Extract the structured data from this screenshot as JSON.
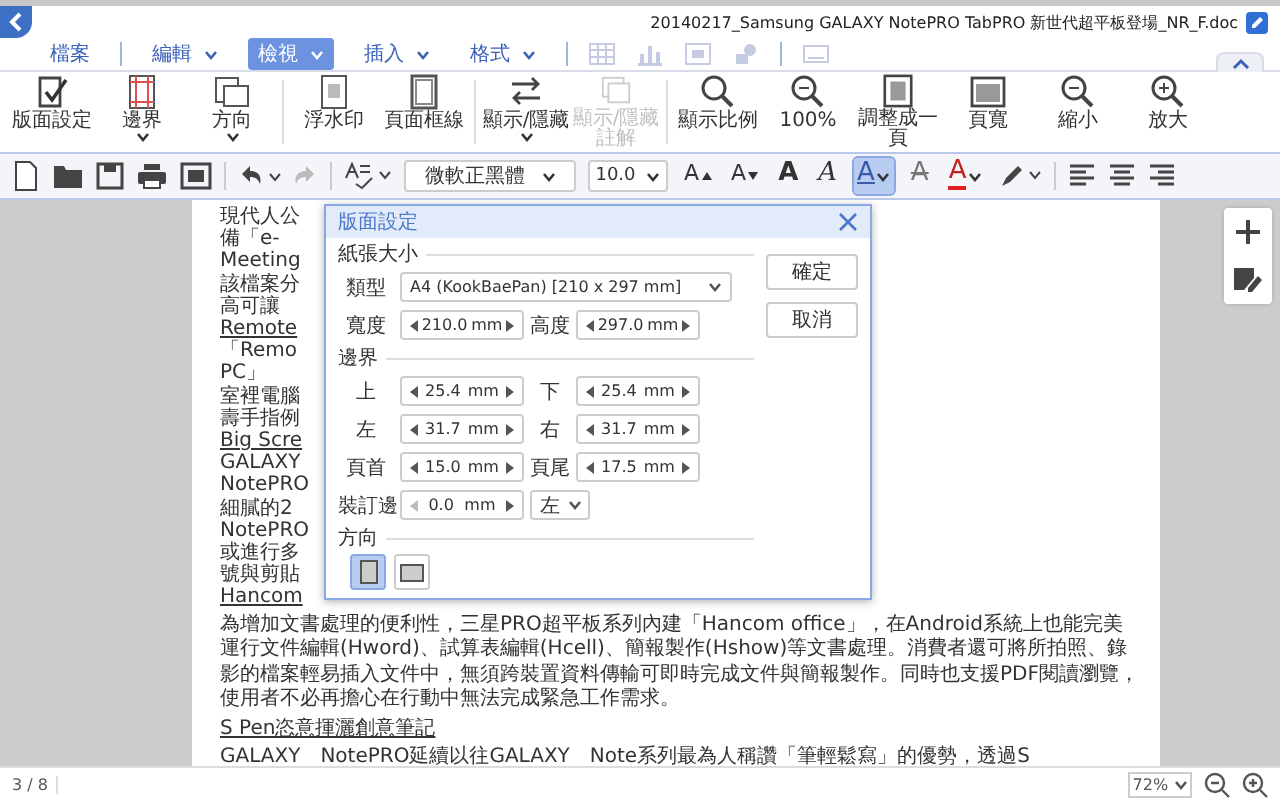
{
  "window": {
    "title": "20140217_Samsung GALAXY NotePRO  TabPRO 新世代超平板登場_NR_F.doc"
  },
  "menu_tabs": [
    {
      "label": "檔案",
      "dropdown": false,
      "selected": false
    },
    {
      "label": "編輯",
      "dropdown": true,
      "selected": false
    },
    {
      "label": "檢視",
      "dropdown": true,
      "selected": true
    },
    {
      "label": "插入",
      "dropdown": true,
      "selected": false
    },
    {
      "label": "格式",
      "dropdown": true,
      "selected": false
    }
  ],
  "ribbon": [
    {
      "kind": "page-setup",
      "label": "版面設定",
      "dropdown": false,
      "disabled": false
    },
    {
      "kind": "margins",
      "label": "邊界",
      "dropdown": true,
      "disabled": false
    },
    {
      "kind": "orientation",
      "label": "方向",
      "dropdown": true,
      "disabled": false
    },
    {
      "kind": "watermark",
      "label": "浮水印",
      "dropdown": false,
      "disabled": false
    },
    {
      "kind": "border",
      "label": "頁面框線",
      "dropdown": false,
      "disabled": false
    },
    {
      "kind": "show-hide",
      "label": "顯示/隱藏",
      "dropdown": true,
      "disabled": false
    },
    {
      "kind": "comments",
      "label": "顯示/隱藏註解",
      "dropdown": false,
      "disabled": true
    },
    {
      "kind": "zoom",
      "label": "顯示比例",
      "dropdown": false,
      "disabled": false
    },
    {
      "kind": "zoom100",
      "label": "100%",
      "dropdown": false,
      "disabled": false
    },
    {
      "kind": "fit-page",
      "label": "調整成一頁",
      "dropdown": false,
      "disabled": false
    },
    {
      "kind": "page-width",
      "label": "頁寬",
      "dropdown": false,
      "disabled": false
    },
    {
      "kind": "zoom-out",
      "label": "縮小",
      "dropdown": false,
      "disabled": false
    },
    {
      "kind": "zoom-in",
      "label": "放大",
      "dropdown": false,
      "disabled": false
    }
  ],
  "toolbar": {
    "font": "微軟正黑體",
    "size": "10.0",
    "text_buttons": [
      {
        "kind": "grow",
        "label": "A",
        "selected": false
      },
      {
        "kind": "shrink",
        "label": "A",
        "selected": false
      },
      {
        "kind": "bold",
        "label": "A",
        "selected": false
      },
      {
        "kind": "italic",
        "label": "A",
        "selected": false
      },
      {
        "kind": "underline",
        "label": "A",
        "selected": true
      },
      {
        "kind": "strike",
        "label": "A",
        "selected": false
      },
      {
        "kind": "color",
        "label": "A",
        "selected": false
      }
    ]
  },
  "document": {
    "fragments": [
      {
        "kind": "body",
        "text": "現代人公"
      },
      {
        "kind": "body",
        "text": "備「e-"
      },
      {
        "kind": "body",
        "text": "Meeting"
      },
      {
        "kind": "body",
        "text": "該檔案分"
      },
      {
        "kind": "body",
        "text": "高可讓"
      },
      {
        "kind": "heading",
        "text": "Remote"
      },
      {
        "kind": "body",
        "text": "「Remo"
      },
      {
        "kind": "body",
        "text": "PC」"
      },
      {
        "kind": "body",
        "text": "室裡電腦"
      },
      {
        "kind": "body",
        "text": "壽手指例"
      },
      {
        "kind": "heading",
        "text": "Big Scre"
      },
      {
        "kind": "body",
        "text": "GALAXY"
      },
      {
        "kind": "body",
        "text": "NotePRO"
      },
      {
        "kind": "body",
        "text": "細膩的2"
      },
      {
        "kind": "body",
        "text": "NotePRO"
      },
      {
        "kind": "body",
        "text": "或進行多"
      },
      {
        "kind": "body",
        "text": "號與剪貼"
      },
      {
        "kind": "heading",
        "text": "Hancom"
      }
    ],
    "paragraphs": [
      {
        "kind": "body",
        "text": "為增加文書處理的便利性，三星PRO超平板系列內建「Hancom office」，在Android系統上也能完美運行文件編輯(Hword)、試算表編輯(Hcell)、簡報製作(Hshow)等文書處理。消費者還可將所拍照、錄影的檔案輕易插入文件中，無須跨裝置資料傳輸可即時完成文件與簡報製作。同時也支援PDF閱讀瀏覽，使用者不必再擔心在行動中無法完成緊急工作需求。"
      },
      {
        "kind": "heading",
        "text": "S Pen恣意揮灑創意筆記"
      },
      {
        "kind": "body",
        "text": "GALAXY　NotePRO延續以往GALAXY　Note系列最為人稱讚「筆輕鬆寫」的優勢，透過S"
      }
    ]
  },
  "dialog": {
    "title": "版面設定",
    "paper": {
      "heading": "紙張大小",
      "type_label": "類型",
      "type_value": "A4 (KookBaePan) [210 x 297 mm]",
      "sizes": [
        {
          "label": "寬度",
          "value": "210.0",
          "unit": "mm"
        },
        {
          "label": "高度",
          "value": "297.0",
          "unit": "mm"
        }
      ]
    },
    "margins": {
      "heading": "邊界",
      "fields": [
        {
          "label": "上",
          "value": "25.4",
          "unit": "mm"
        },
        {
          "label": "下",
          "value": "25.4",
          "unit": "mm"
        },
        {
          "label": "左",
          "value": "31.7",
          "unit": "mm"
        },
        {
          "label": "右",
          "value": "31.7",
          "unit": "mm"
        },
        {
          "label": "頁首",
          "value": "15.0",
          "unit": "mm"
        },
        {
          "label": "頁尾",
          "value": "17.5",
          "unit": "mm"
        }
      ],
      "gutter": {
        "label": "裝訂邊",
        "value": "0.0",
        "unit": "mm",
        "side": "左"
      }
    },
    "orientation": {
      "heading": "方向",
      "options": [
        {
          "kind": "portrait",
          "selected": true
        },
        {
          "kind": "landscape",
          "selected": false
        }
      ]
    },
    "buttons": [
      "確定",
      "取消"
    ]
  },
  "status_bar": {
    "page": "3 / 8",
    "zoom": "72%"
  }
}
